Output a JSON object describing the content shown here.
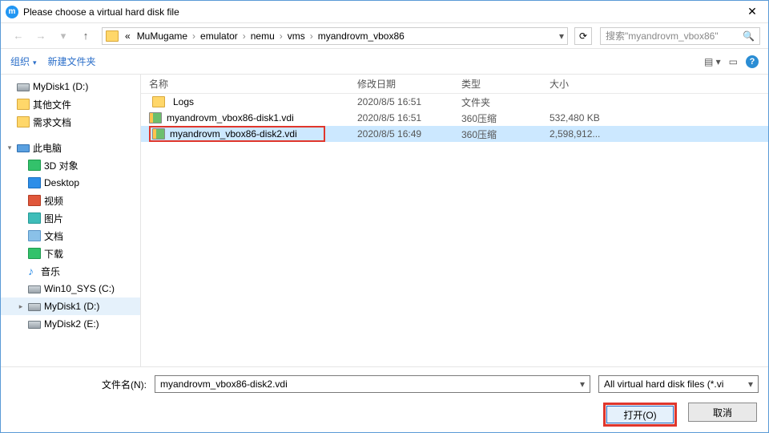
{
  "title": "Please choose a virtual hard disk file",
  "breadcrumb": {
    "prefix": "«",
    "parts": [
      "MuMugame",
      "emulator",
      "nemu",
      "vms",
      "myandrovm_vbox86"
    ]
  },
  "search": {
    "placeholder": "搜索\"myandrovm_vbox86\""
  },
  "toolbar": {
    "organize": "组织",
    "newfolder": "新建文件夹"
  },
  "sidebar": {
    "items": [
      {
        "label": "MyDisk1 (D:)",
        "icon": "drive"
      },
      {
        "label": "其他文件",
        "icon": "folder"
      },
      {
        "label": "需求文档",
        "icon": "folder"
      },
      {
        "label": "此电脑",
        "icon": "pc",
        "header": true
      },
      {
        "label": "3D 对象",
        "icon": "green"
      },
      {
        "label": "Desktop",
        "icon": "blue"
      },
      {
        "label": "视频",
        "icon": "red"
      },
      {
        "label": "图片",
        "icon": "pic"
      },
      {
        "label": "文档",
        "icon": "doc"
      },
      {
        "label": "下载",
        "icon": "green"
      },
      {
        "label": "音乐",
        "icon": "music"
      },
      {
        "label": "Win10_SYS (C:)",
        "icon": "drive"
      },
      {
        "label": "MyDisk1 (D:)",
        "icon": "drive",
        "selected": true
      },
      {
        "label": "MyDisk2 (E:)",
        "icon": "drive"
      }
    ]
  },
  "columns": {
    "name": "名称",
    "date": "修改日期",
    "type": "类型",
    "size": "大小"
  },
  "files": [
    {
      "name": "Logs",
      "date": "2020/8/5 16:51",
      "type": "文件夹",
      "size": "",
      "icon": "folder"
    },
    {
      "name": "myandrovm_vbox86-disk1.vdi",
      "date": "2020/8/5 16:51",
      "type": "360压缩",
      "size": "532,480 KB",
      "icon": "disk"
    },
    {
      "name": "myandrovm_vbox86-disk2.vdi",
      "date": "2020/8/5 16:49",
      "type": "360压缩",
      "size": "2,598,912...",
      "icon": "disk",
      "selected": true,
      "highlighted": true
    }
  ],
  "footer": {
    "filename_label": "文件名(N):",
    "filename_value": "myandrovm_vbox86-disk2.vdi",
    "filter": "All virtual hard disk files (*.vi",
    "open": "打开(O)",
    "cancel": "取消"
  }
}
